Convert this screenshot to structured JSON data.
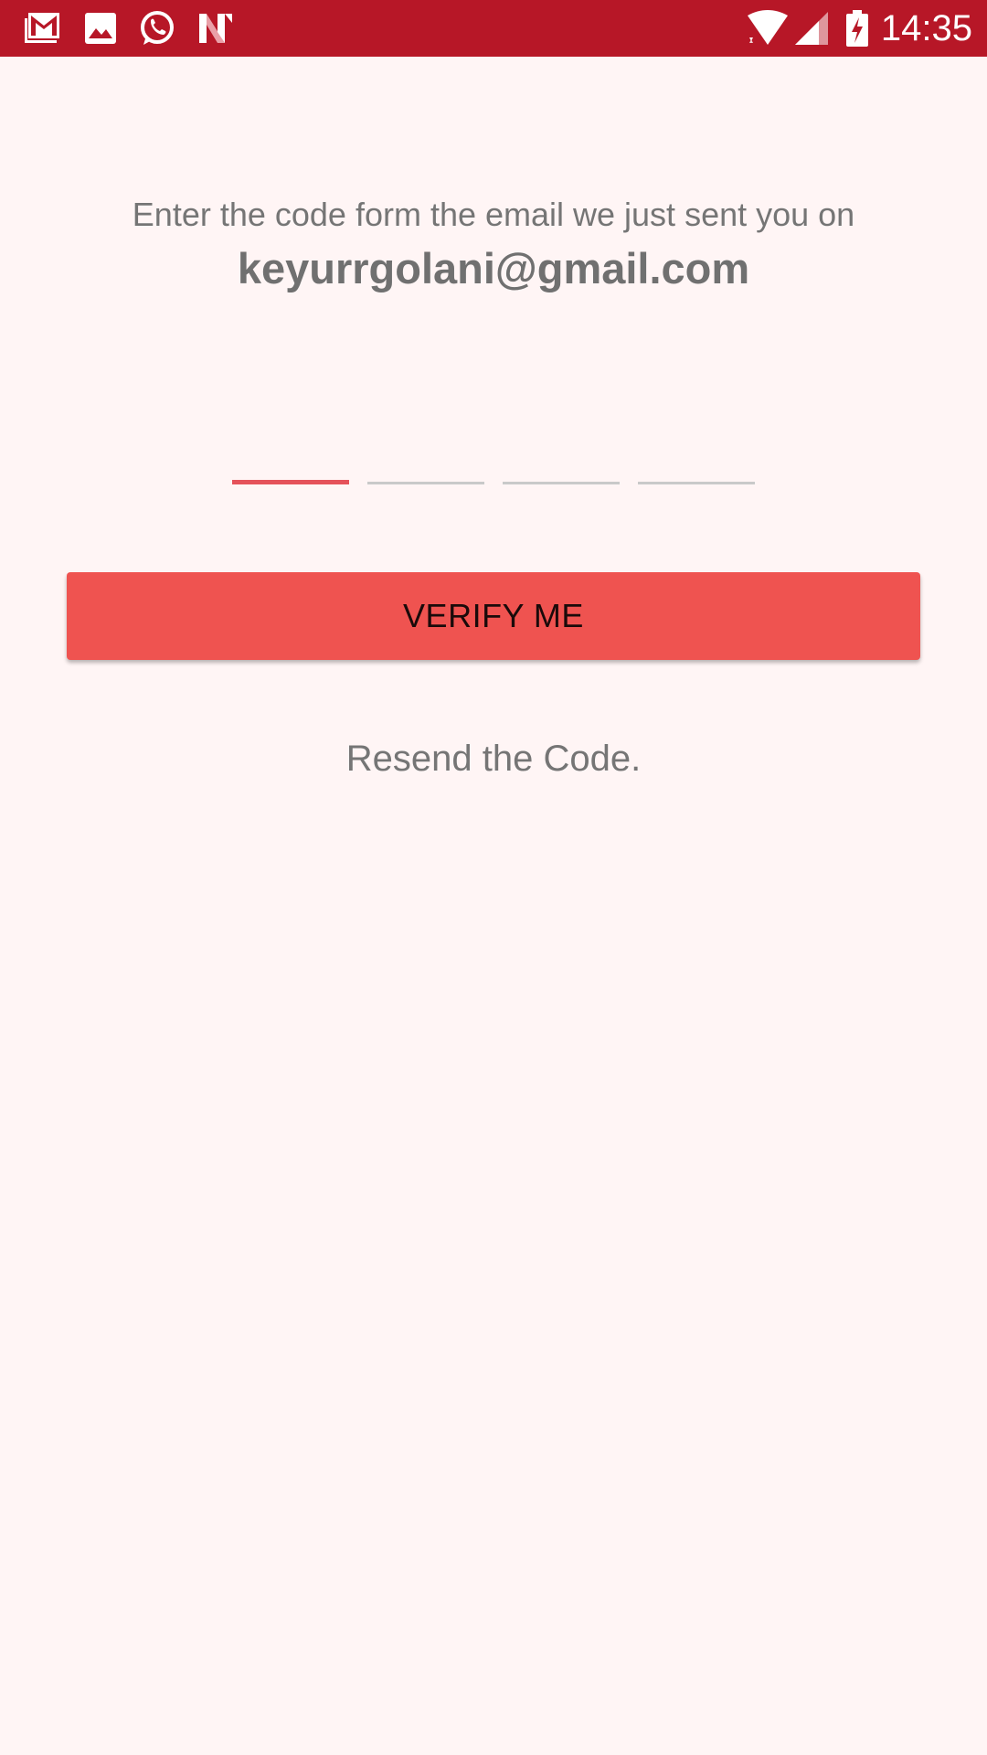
{
  "status_bar": {
    "time": "14:35",
    "background": "#B71727",
    "notification_icons": [
      "gmail-icon",
      "gallery-icon",
      "whatsapp-icon",
      "app-n-icon"
    ],
    "system_icons": [
      "wifi-icon",
      "cellular-signal-icon",
      "battery-charging-icon"
    ]
  },
  "verification": {
    "instruction": "Enter the code form the email we just sent you on",
    "email": "keyurrgolani@gmail.com",
    "code_digits": [
      "",
      "",
      "",
      ""
    ],
    "active_digit": 1,
    "verify_label": "VERIFY ME",
    "resend_label": "Resend the Code."
  },
  "colors": {
    "background": "#FFF5F5",
    "accent": "#EF5350",
    "active_underline": "#E5525A",
    "inactive_underline": "#C9C9C9",
    "text_muted": "#757575"
  }
}
